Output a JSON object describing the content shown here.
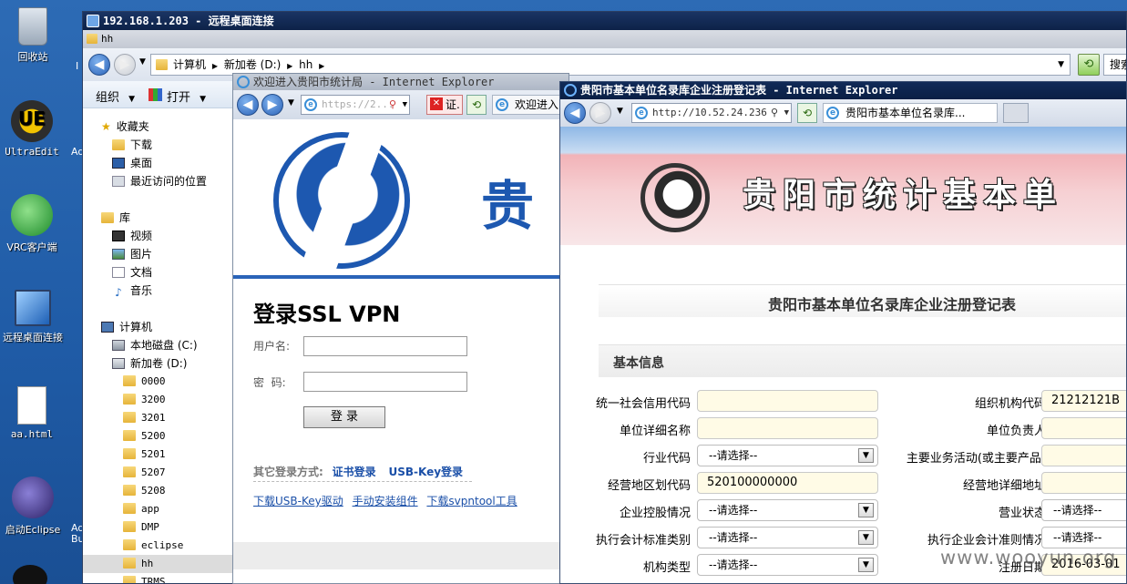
{
  "desktop": {
    "icons": [
      {
        "label": "回收站",
        "icon": "recycle-bin-icon"
      },
      {
        "label": "UltraEdit",
        "icon": "ultraedit-icon"
      },
      {
        "label": "VRC客户端",
        "icon": "vrc-client-icon"
      },
      {
        "label": "远程桌面连接",
        "icon": "remote-desktop-icon"
      },
      {
        "label": "aa.html",
        "icon": "html-file-icon"
      },
      {
        "label": "启动Eclipse",
        "icon": "eclipse-icon"
      }
    ],
    "partial_labels": [
      "I",
      "Ad",
      "Ad",
      "Bu"
    ]
  },
  "rdp": {
    "title": "192.168.1.203 - 远程桌面连接"
  },
  "explorer": {
    "title": "hh",
    "breadcrumb": [
      "计算机",
      "新加卷 (D:)",
      "hh"
    ],
    "search_partial": "搜索",
    "toolbar": {
      "organize": "组织",
      "open": "打开"
    },
    "nav": {
      "favorites": "收藏夹",
      "favorites_items": [
        "下载",
        "桌面",
        "最近访问的位置"
      ],
      "libraries": "库",
      "library_items": [
        "视频",
        "图片",
        "文档",
        "音乐"
      ],
      "computer": "计算机",
      "drives": [
        "本地磁盘 (C:)",
        "新加卷 (D:)"
      ],
      "folders": [
        "0000",
        "3200",
        "3201",
        "5200",
        "5201",
        "5207",
        "5208",
        "app",
        "DMP",
        "eclipse",
        "hh",
        "TRMS"
      ]
    }
  },
  "ie1": {
    "title": "欢迎进入贵阳市统计局 - Internet Explorer",
    "address": "https://2...",
    "cert_label": "证.",
    "tab_label": "欢迎进入",
    "banner_text": "贵",
    "heading": "登录SSL VPN",
    "username_label": "用户名:",
    "password_label": "密  码:",
    "login_button": "登 录",
    "other_methods_label": "其它登录方式:",
    "cert_login": "证书登录",
    "usbkey_login": "USB-Key登录",
    "links": [
      "下载USB-Key驱动",
      "手动安装组件",
      "下载svpntool工具"
    ]
  },
  "ie2": {
    "title": "贵阳市基本单位名录库企业注册登记表 - Internet Explorer",
    "address": "http://10.52.24.236",
    "tab_label": "贵阳市基本单位名录库...",
    "banner_text": "贵阳市统计基本单",
    "form_title": "贵阳市基本单位名录库企业注册登记表",
    "section": "基本信息",
    "left_fields": [
      {
        "label": "统一社会信用代码",
        "value": "",
        "type": "text"
      },
      {
        "label": "单位详细名称",
        "value": "",
        "type": "text"
      },
      {
        "label": "行业代码",
        "value": "--请选择--",
        "type": "select"
      },
      {
        "label": "经营地区划代码",
        "value": "520100000000",
        "type": "text"
      },
      {
        "label": "企业控股情况",
        "value": "--请选择--",
        "type": "select"
      },
      {
        "label": "执行会计标准类别",
        "value": "--请选择--",
        "type": "select"
      },
      {
        "label": "机构类型",
        "value": "--请选择--",
        "type": "select"
      }
    ],
    "right_fields": [
      {
        "label": "组织机构代码",
        "value": "21212121B",
        "type": "text"
      },
      {
        "label": "单位负责人",
        "value": "",
        "type": "text"
      },
      {
        "label": "主要业务活动(或主要产品)",
        "value": "",
        "type": "text"
      },
      {
        "label": "经营地详细地址",
        "value": "",
        "type": "text"
      },
      {
        "label": "营业状态",
        "value": "--请选择--",
        "type": "select"
      },
      {
        "label": "执行企业会计准则情况",
        "value": "--请选择--",
        "type": "select"
      },
      {
        "label": "注册日期",
        "value": "2016-03-01",
        "type": "text"
      }
    ]
  },
  "watermark": "www.wooyun.org"
}
